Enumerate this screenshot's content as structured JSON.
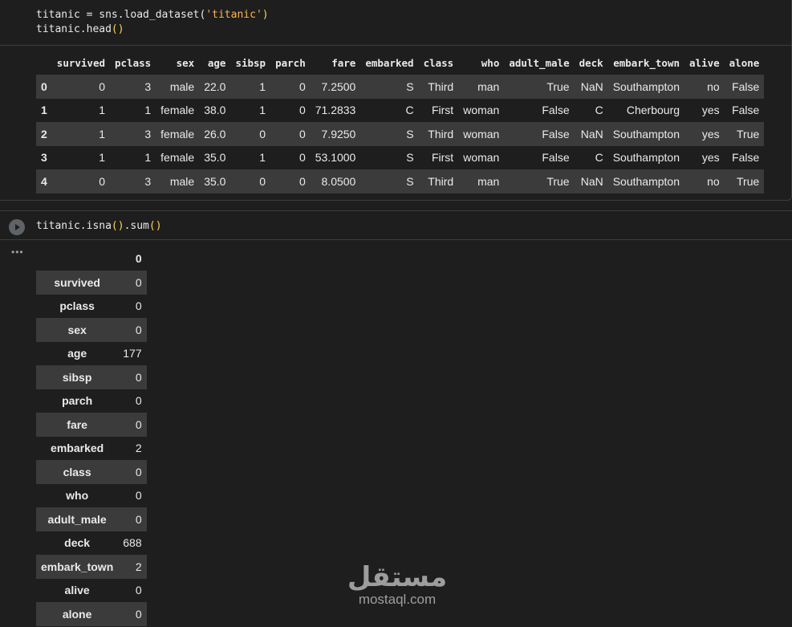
{
  "cell1": {
    "code_line1_a": "titanic = sns.load_dataset(",
    "code_line1_str": "'titanic'",
    "code_line1_close": ")",
    "code_line2_a": "titanic.head",
    "code_line2_paren": "()"
  },
  "head_table": {
    "columns": [
      "survived",
      "pclass",
      "sex",
      "age",
      "sibsp",
      "parch",
      "fare",
      "embarked",
      "class",
      "who",
      "adult_male",
      "deck",
      "embark_town",
      "alive",
      "alone"
    ],
    "rows": [
      {
        "index": "0",
        "cells": [
          "0",
          "3",
          "male",
          "22.0",
          "1",
          "0",
          "7.2500",
          "S",
          "Third",
          "man",
          "True",
          "NaN",
          "Southampton",
          "no",
          "False"
        ]
      },
      {
        "index": "1",
        "cells": [
          "1",
          "1",
          "female",
          "38.0",
          "1",
          "0",
          "71.2833",
          "C",
          "First",
          "woman",
          "False",
          "C",
          "Cherbourg",
          "yes",
          "False"
        ]
      },
      {
        "index": "2",
        "cells": [
          "1",
          "3",
          "female",
          "26.0",
          "0",
          "0",
          "7.9250",
          "S",
          "Third",
          "woman",
          "False",
          "NaN",
          "Southampton",
          "yes",
          "True"
        ]
      },
      {
        "index": "3",
        "cells": [
          "1",
          "1",
          "female",
          "35.0",
          "1",
          "0",
          "53.1000",
          "S",
          "First",
          "woman",
          "False",
          "C",
          "Southampton",
          "yes",
          "False"
        ]
      },
      {
        "index": "4",
        "cells": [
          "0",
          "3",
          "male",
          "35.0",
          "0",
          "0",
          "8.0500",
          "S",
          "Third",
          "man",
          "True",
          "NaN",
          "Southampton",
          "no",
          "True"
        ]
      }
    ]
  },
  "cell2": {
    "code_a": "titanic.isna",
    "code_p1": "()",
    "code_b": ".sum",
    "code_p2": "()",
    "output_marker": "•••",
    "header": "0",
    "rows": [
      {
        "label": "survived",
        "value": "0"
      },
      {
        "label": "pclass",
        "value": "0"
      },
      {
        "label": "sex",
        "value": "0"
      },
      {
        "label": "age",
        "value": "177"
      },
      {
        "label": "sibsp",
        "value": "0"
      },
      {
        "label": "parch",
        "value": "0"
      },
      {
        "label": "fare",
        "value": "0"
      },
      {
        "label": "embarked",
        "value": "2"
      },
      {
        "label": "class",
        "value": "0"
      },
      {
        "label": "who",
        "value": "0"
      },
      {
        "label": "adult_male",
        "value": "0"
      },
      {
        "label": "deck",
        "value": "688"
      },
      {
        "label": "embark_town",
        "value": "2"
      },
      {
        "label": "alive",
        "value": "0"
      },
      {
        "label": "alone",
        "value": "0"
      }
    ]
  },
  "watermark": {
    "arabic": "مستقل",
    "latin": "mostaql.com"
  },
  "colors": {
    "background": "#1e1e1e",
    "stripe": "#3b3b3b",
    "string": "#ffb74d",
    "paren": "#ffd54f"
  }
}
